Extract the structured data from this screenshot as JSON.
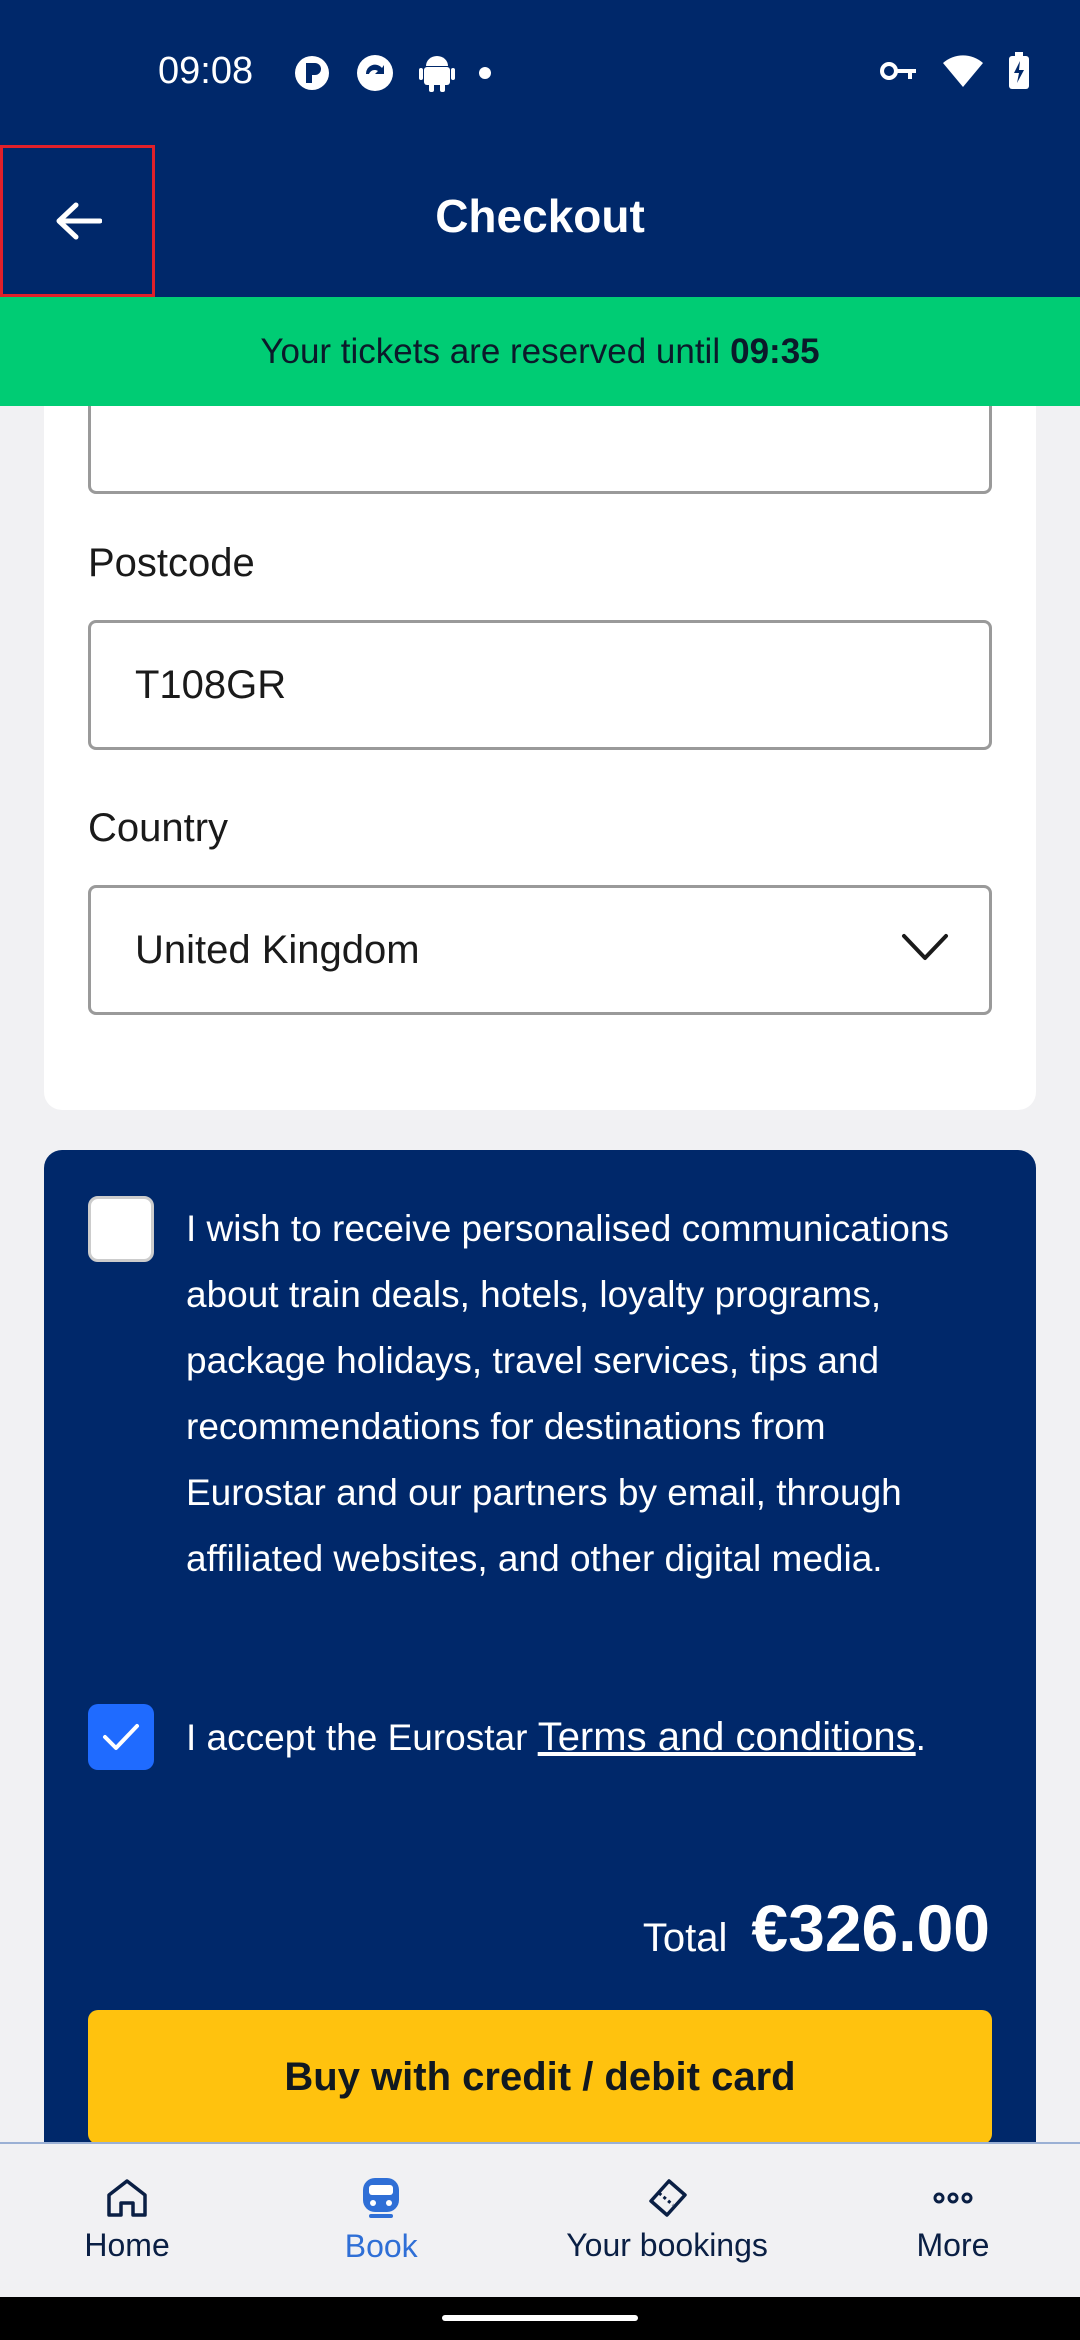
{
  "status_bar": {
    "time": "09:08",
    "left_icons": [
      "notification-p-icon",
      "sync-app-icon",
      "android-icon",
      "dot-icon"
    ],
    "right_icons": [
      "vpn-key-icon",
      "wifi-icon",
      "battery-charging-icon"
    ]
  },
  "app_bar": {
    "title": "Checkout",
    "back_icon": "arrow-left-icon"
  },
  "banner": {
    "prefix": "Your tickets are reserved until",
    "time": "09:35"
  },
  "address_form": {
    "postcode_label": "Postcode",
    "postcode_value": "T108GR",
    "country_label": "Country",
    "country_value": "United Kingdom"
  },
  "consent": {
    "marketing_text": "I wish to receive personalised communications about train deals, hotels, loyalty programs, package holidays, travel services, tips and recommendations for destinations from Eurostar and our partners by email, through affiliated websites, and other digital media.",
    "marketing_checked": false,
    "terms_prefix": "I accept the Eurostar",
    "terms_link": "Terms and conditions",
    "terms_suffix": ".",
    "terms_checked": true
  },
  "payment": {
    "total_label": "Total",
    "total_value": "€326.00",
    "buy_button": "Buy with credit / debit card"
  },
  "bottom_nav": {
    "items": [
      {
        "label": "Home",
        "icon": "home-icon"
      },
      {
        "label": "Book",
        "icon": "train-icon"
      },
      {
        "label": "Your bookings",
        "icon": "ticket-icon"
      },
      {
        "label": "More",
        "icon": "more-dots-icon"
      }
    ],
    "active": "Book"
  },
  "colors": {
    "brand_navy": "#00286a",
    "banner_green": "#00cc74",
    "button_yellow": "#ffc20e",
    "checkbox_blue": "#1f6bff",
    "nav_active": "#2f6fd6"
  }
}
